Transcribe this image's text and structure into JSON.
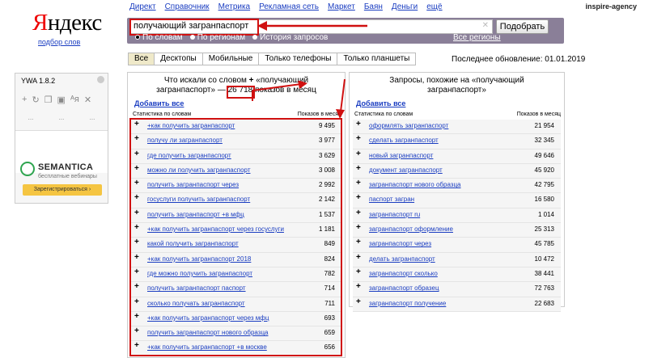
{
  "nav": {
    "links": [
      "Директ",
      "Справочник",
      "Метрика",
      "Рекламная сеть",
      "Маркет",
      "Баян",
      "Деньги",
      "ещё"
    ],
    "agency": "inspire-agency"
  },
  "logo": {
    "first_letter": "Я",
    "rest": "ндекс",
    "subtitle": "подбор слов"
  },
  "search": {
    "query": "получающий загранпаспорт",
    "button": "Подобрать",
    "clear_icon": "close-icon",
    "modes": [
      "По словам",
      "По регионам",
      "История запросов"
    ],
    "selected_mode": "По словам",
    "regions": "Все регионы"
  },
  "tabs": [
    "Все",
    "Десктопы",
    "Мобильные",
    "Только телефоны",
    "Только планшеты"
  ],
  "active_tab": "Все",
  "last_update": "Последнее обновление: 01.01.2019",
  "widget": {
    "title": "YWA 1.8.2",
    "brand": "SEMANTICA",
    "brand_sub": "бесплатные вебинары",
    "register": "Зарегистрироваться ›"
  },
  "left": {
    "title_pre": "Что искали со словом",
    "title_plus": "+",
    "title_query": "«получающий загранпаспорт»",
    "dash": "—",
    "count": "26 718",
    "title_post": "показов в месяц",
    "add_all": "Добавить все",
    "col_stats": "Статистика по словам",
    "col_count": "Показов в месяц",
    "rows": [
      {
        "phrase": "+как получить загранпаспорт",
        "count": "9 495"
      },
      {
        "phrase": "получу ли загранпаспорт",
        "count": "3 977"
      },
      {
        "phrase": "где получить загранпаспорт",
        "count": "3 629"
      },
      {
        "phrase": "можно ли получить загранпаспорт",
        "count": "3 008"
      },
      {
        "phrase": "получить загранпаспорт через",
        "count": "2 992"
      },
      {
        "phrase": "госуслуги получить загранпаспорт",
        "count": "2 142"
      },
      {
        "phrase": "получить загранпаспорт +в мфц",
        "count": "1 537"
      },
      {
        "phrase": "+как получить загранпаспорт через госуслуги",
        "count": "1 181"
      },
      {
        "phrase": "какой получить загранпаспорт",
        "count": "849"
      },
      {
        "phrase": "+как получить загранпаспорт 2018",
        "count": "824"
      },
      {
        "phrase": "где можно получить загранпаспорт",
        "count": "782"
      },
      {
        "phrase": "получить загранпаспорт паспорт",
        "count": "714"
      },
      {
        "phrase": "сколько получать загранпаспорт",
        "count": "711"
      },
      {
        "phrase": "+как получить загранпаспорт через мфц",
        "count": "693"
      },
      {
        "phrase": "получить загранпаспорт нового образца",
        "count": "659"
      },
      {
        "phrase": "+как получить загранпаспорт +в москве",
        "count": "656"
      }
    ]
  },
  "right": {
    "title": "Запросы, похожие на «получающий загранпаспорт»",
    "add_all": "Добавить все",
    "col_stats": "Статистика по словам",
    "col_count": "Показов в месяц",
    "rows": [
      {
        "phrase": "оформлять загранпаспорт",
        "count": "21 954"
      },
      {
        "phrase": "сделать загранпаспорт",
        "count": "32 345"
      },
      {
        "phrase": "новый загранпаспорт",
        "count": "49 646"
      },
      {
        "phrase": "документ загранпаспорт",
        "count": "45 920"
      },
      {
        "phrase": "загранпаспорт нового образца",
        "count": "42 795"
      },
      {
        "phrase": "паспорт загран",
        "count": "16 580"
      },
      {
        "phrase": "загранпаспорт ru",
        "count": "1 014"
      },
      {
        "phrase": "загранпаспорт оформление",
        "count": "25 313"
      },
      {
        "phrase": "загранпаспорт через",
        "count": "45 785"
      },
      {
        "phrase": "делать загранпаспорт",
        "count": "10 472"
      },
      {
        "phrase": "загранпаспорт сколько",
        "count": "38 441"
      },
      {
        "phrase": "загранпаспорт образец",
        "count": "72 763"
      },
      {
        "phrase": "загранпаспорт получение",
        "count": "22 683"
      }
    ]
  },
  "accent": {
    "red": "#d01010",
    "link": "#1a3dc1",
    "bar": "#8a7f98",
    "tab_active": "#efe9c9"
  }
}
